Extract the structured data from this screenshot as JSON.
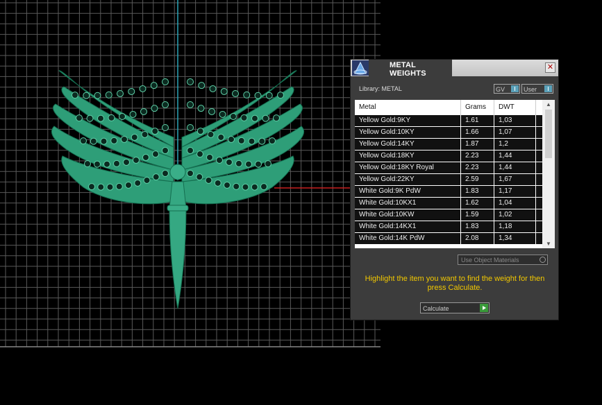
{
  "panel": {
    "title": "METAL WEIGHTS",
    "close_label": "✕",
    "library_label": "Library: METAL",
    "gv_label": "GV",
    "user_label": "User",
    "use_object_materials": "Use Object Materials",
    "hint": "Highlight the item you want to find the weight for then press Calculate.",
    "calculate_label": "Calculate"
  },
  "table": {
    "headers": [
      "Metal",
      "Grams",
      "DWT"
    ],
    "rows": [
      {
        "metal": "Yellow Gold:9KY",
        "grams": "1.61",
        "dwt": "1,03"
      },
      {
        "metal": "Yellow Gold:10KY",
        "grams": "1.66",
        "dwt": "1,07"
      },
      {
        "metal": "Yellow Gold:14KY",
        "grams": "1.87",
        "dwt": "1,2"
      },
      {
        "metal": "Yellow Gold:18KY",
        "grams": "2.23",
        "dwt": "1,44"
      },
      {
        "metal": "Yellow Gold:18KY Royal",
        "grams": "2.23",
        "dwt": "1,44"
      },
      {
        "metal": "Yellow Gold:22KY",
        "grams": "2.59",
        "dwt": "1,67"
      },
      {
        "metal": "White Gold:9K PdW",
        "grams": "1.83",
        "dwt": "1,17"
      },
      {
        "metal": "White Gold:10KX1",
        "grams": "1.62",
        "dwt": "1,04"
      },
      {
        "metal": "White Gold:10KW",
        "grams": "1.59",
        "dwt": "1,02"
      },
      {
        "metal": "White Gold:14KX1",
        "grams": "1.83",
        "dwt": "1,18"
      },
      {
        "metal": "White Gold:14K PdW",
        "grams": "2.08",
        "dwt": "1,34"
      }
    ]
  },
  "colors": {
    "hint_text": "#f2c800",
    "model_green": "#2e9e78",
    "axis_cyan": "#2aa6b8",
    "axis_red": "#c82020"
  },
  "icons": [
    "app-logo-icon",
    "close-icon",
    "scroll-up-icon",
    "scroll-down-icon",
    "calculate-go-icon"
  ]
}
